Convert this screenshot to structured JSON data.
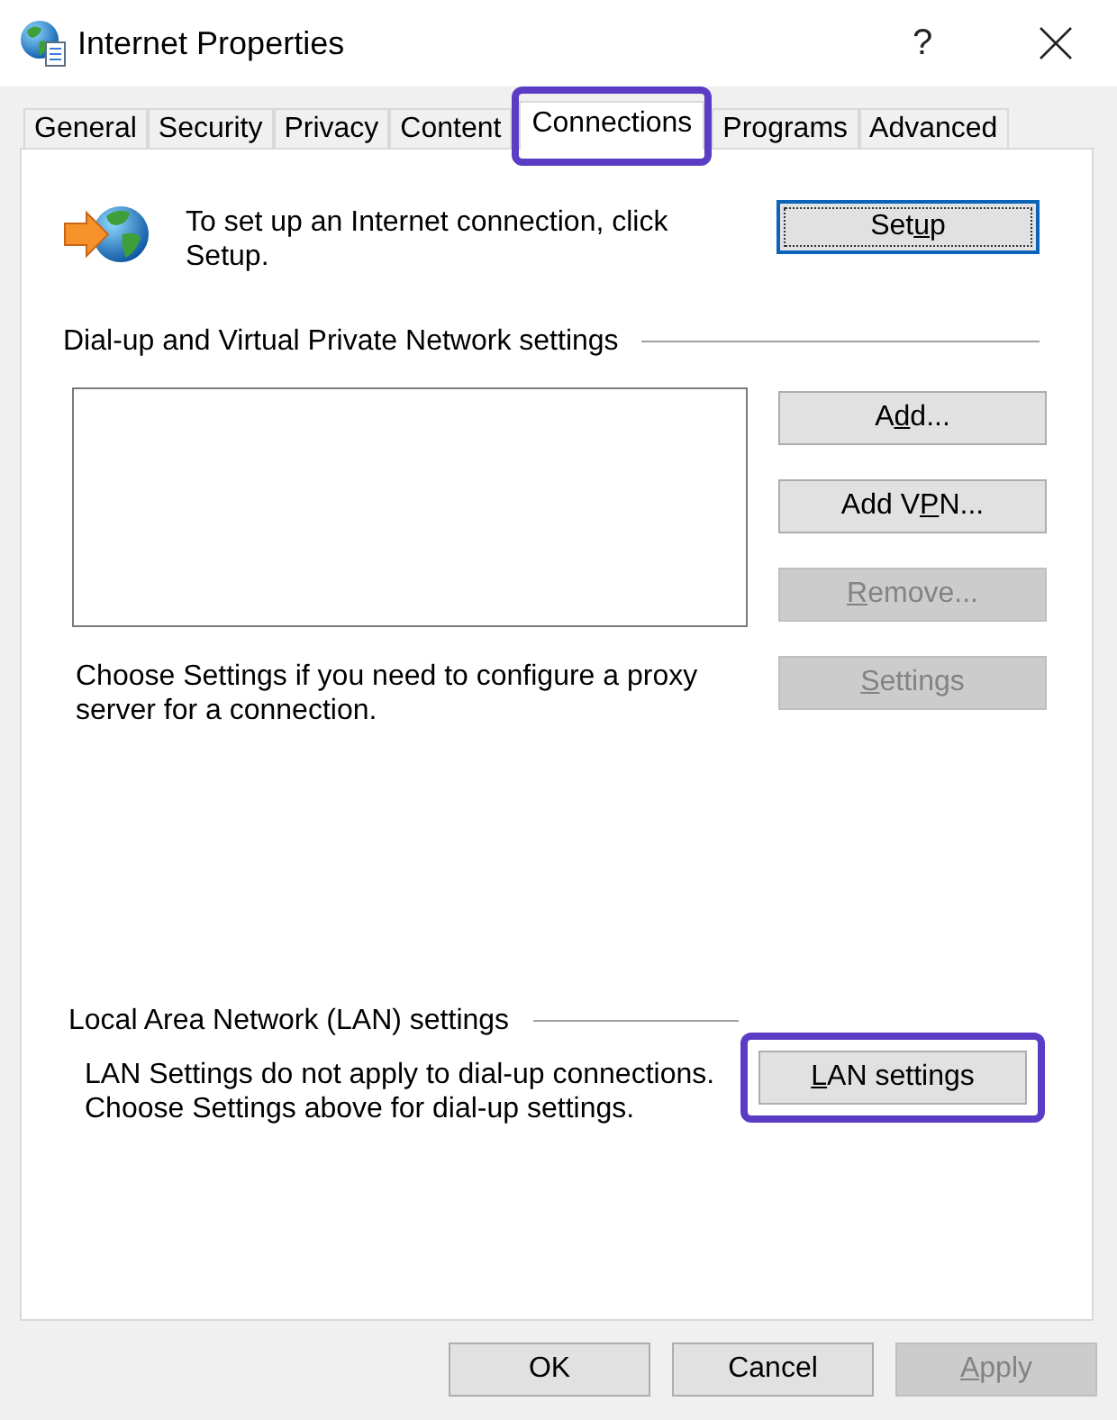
{
  "window": {
    "title": "Internet Properties",
    "help_button": "?"
  },
  "tabs": [
    {
      "label": "General",
      "selected": false,
      "highlighted": false
    },
    {
      "label": "Security",
      "selected": false,
      "highlighted": false
    },
    {
      "label": "Privacy",
      "selected": false,
      "highlighted": false
    },
    {
      "label": "Content",
      "selected": false,
      "highlighted": false
    },
    {
      "label": "Connections",
      "selected": true,
      "highlighted": true
    },
    {
      "label": "Programs",
      "selected": false,
      "highlighted": false
    },
    {
      "label": "Advanced",
      "selected": false,
      "highlighted": false
    }
  ],
  "setup": {
    "text": "To set up an Internet connection, click Setup.",
    "button": {
      "label": {
        "start": "Set",
        "underlined": "u",
        "end": "p"
      },
      "disabled": false,
      "focused": true,
      "highlighted": false
    }
  },
  "dialup": {
    "heading": "Dial-up and Virtual Private Network settings",
    "buttons": [
      {
        "label": {
          "start": "A",
          "underlined": "d",
          "end": "d..."
        },
        "disabled": false,
        "focused": false,
        "highlighted": false
      },
      {
        "label": {
          "start": "Add V",
          "underlined": "P",
          "end": "N..."
        },
        "disabled": false,
        "focused": false,
        "highlighted": false
      },
      {
        "label": {
          "underlined": "R",
          "end": "emove..."
        },
        "disabled": true,
        "focused": false,
        "highlighted": false
      },
      {
        "label": {
          "underlined": "S",
          "end": "ettings"
        },
        "disabled": true,
        "focused": false,
        "highlighted": false
      }
    ],
    "proxy_hint": "Choose Settings if you need to configure a proxy server for a connection."
  },
  "lan": {
    "heading": "Local Area Network (LAN) settings",
    "hint": "LAN Settings do not apply to dial-up connections. Choose Settings above for dial-up settings.",
    "button": {
      "label": {
        "underlined": "L",
        "end": "AN settings"
      },
      "disabled": false,
      "focused": false,
      "highlighted": true
    }
  },
  "footer_buttons": [
    {
      "label": {
        "start": "OK"
      },
      "disabled": false,
      "focused": false,
      "highlighted": false
    },
    {
      "label": {
        "start": "Cancel"
      },
      "disabled": false,
      "focused": false,
      "highlighted": false
    },
    {
      "label": {
        "underlined": "A",
        "end": "pply"
      },
      "disabled": true,
      "focused": false,
      "highlighted": false
    }
  ]
}
